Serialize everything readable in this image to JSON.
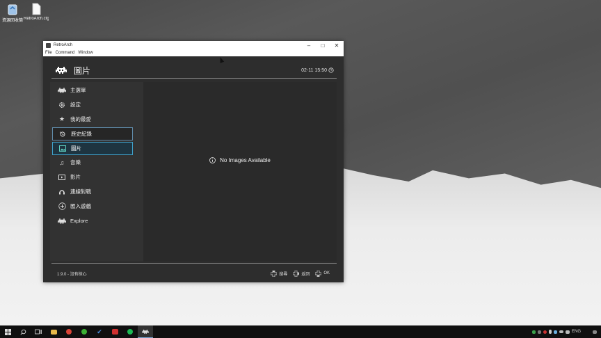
{
  "desktop": {
    "icons": [
      {
        "label": "資源回收筒",
        "icon": "recycle-bin-icon"
      },
      {
        "label": "RetroArch.cfg",
        "icon": "file-icon"
      }
    ]
  },
  "window": {
    "title": "RetroArch",
    "menu": [
      "File",
      "Command",
      "Window"
    ]
  },
  "retroarch": {
    "header": {
      "title": "圖片",
      "clock": "02-11 15:50"
    },
    "sidebar": [
      {
        "label": "主選單",
        "icon": "invader-icon"
      },
      {
        "label": "設定",
        "icon": "gear-icon"
      },
      {
        "label": "我的最愛",
        "icon": "star-icon"
      },
      {
        "label": "歷史紀錄",
        "icon": "history-icon"
      },
      {
        "label": "圖片",
        "icon": "image-icon"
      },
      {
        "label": "音樂",
        "icon": "music-icon"
      },
      {
        "label": "影片",
        "icon": "video-icon"
      },
      {
        "label": "連線對戰",
        "icon": "netplay-icon"
      },
      {
        "label": "匯入遊戲",
        "icon": "add-icon"
      },
      {
        "label": "Explore",
        "icon": "invader-icon"
      }
    ],
    "selected_index": 4,
    "hover_index": 3,
    "empty_message": "No Images Available",
    "footer": {
      "version": "1.9.0 - 沒有核心",
      "hints": [
        {
          "label": "搜尋",
          "icon": "dpad-icon"
        },
        {
          "label": "返回",
          "icon": "dpad-icon"
        },
        {
          "label": "OK",
          "icon": "dpad-icon"
        }
      ]
    }
  },
  "taskbar": {
    "language": "ENG",
    "colors": {
      "accent": "#7aa6d6",
      "selection": "#3fa0c8"
    }
  }
}
